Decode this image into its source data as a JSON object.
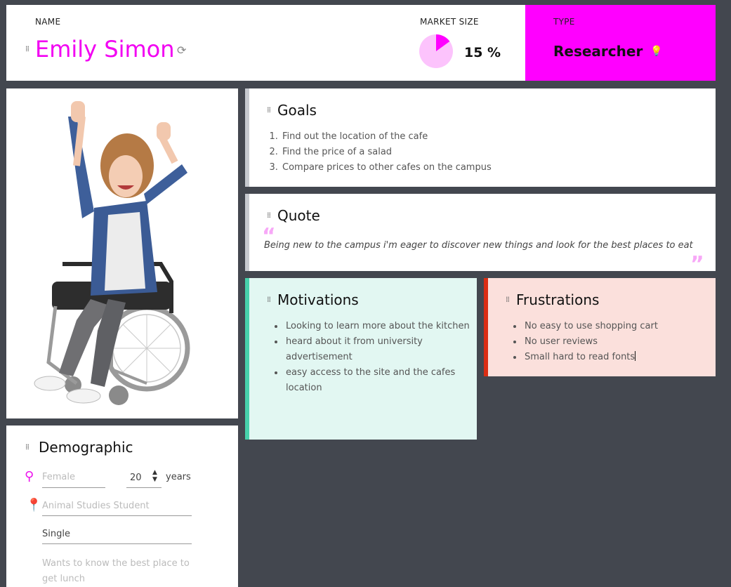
{
  "header": {
    "name_label": "NAME",
    "name": "Emily Simon",
    "market_label": "MARKET SIZE",
    "market_value": "15 %",
    "market_fraction": 0.15,
    "type_label": "TYPE",
    "type_value": "Researcher"
  },
  "goals": {
    "title": "Goals",
    "items": [
      "Find out the location of the cafe",
      "Find the price of a salad",
      "Compare prices to other cafes on the campus"
    ]
  },
  "quote": {
    "title": "Quote",
    "text": "Being new to the campus i'm eager to discover new things and look for the best places to eat"
  },
  "motivations": {
    "title": "Motivations",
    "items": [
      "Looking to learn more about the kitchen",
      "heard about it from university advertisement",
      "easy access to the site and the cafes location"
    ]
  },
  "frustrations": {
    "title": "Frustrations",
    "items": [
      "No easy to use shopping cart",
      "No user reviews",
      "Small hard to read fonts"
    ]
  },
  "demographic": {
    "title": "Demographic",
    "gender_placeholder": "Female",
    "age_value": "20",
    "age_unit": "years",
    "location_placeholder": "Animal Studies Student",
    "status_value": "Single",
    "notes_placeholder": "Wants to know the best place to get lunch"
  },
  "colors": {
    "accent": "#ff00ff",
    "name_color": "#f200f2",
    "motivations_bg": "#e2f7f2",
    "motivations_border": "#47d1ab",
    "frustrations_bg": "#fbe0dc",
    "frustrations_border": "#db2e14",
    "background": "#43474f"
  },
  "icons": [
    "drag-handle-icon",
    "refresh-icon",
    "lightbulb-icon",
    "gender-icon",
    "location-pin-icon",
    "quote-open-icon",
    "quote-close-icon",
    "stepper-arrows-icon"
  ]
}
